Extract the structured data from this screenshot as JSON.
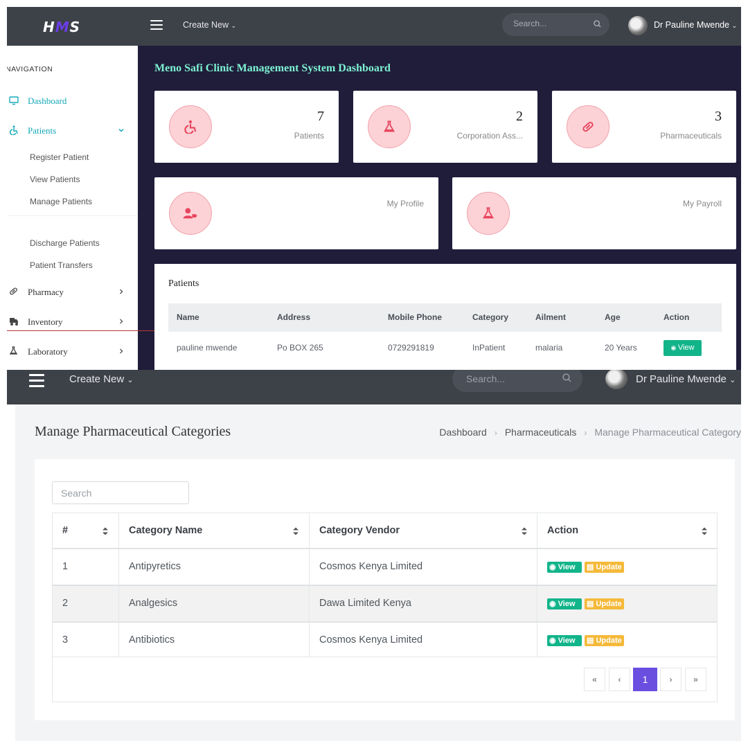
{
  "dashboard": {
    "topbar": {
      "logo_text_1": "H",
      "logo_text_2": "M",
      "logo_text_3": "S",
      "create_new_label": "Create New",
      "search_placeholder": "Search...",
      "user_name": "Dr Pauline Mwende"
    },
    "sidebar": {
      "heading": "NAVIGATION",
      "dashboard_label": "Dashboard",
      "patients_label": "Patients",
      "patients_sub": [
        "Register Patient",
        "View Patients",
        "Manage Patients",
        "Discharge Patients",
        "Patient Transfers"
      ],
      "pharmacy_label": "Pharmacy",
      "inventory_label": "Inventory",
      "laboratory_label": "Laboratory"
    },
    "title": "Meno Safi Clinic Management System Dashboard",
    "stat_cards": [
      {
        "value": "7",
        "label": "Patients",
        "icon": "wheelchair-icon"
      },
      {
        "value": "2",
        "label": "Corporation Ass...",
        "icon": "flask-icon"
      },
      {
        "value": "3",
        "label": "Pharmaceuticals",
        "icon": "pill-icon"
      }
    ],
    "link_cards": [
      {
        "label": "My Profile",
        "icon": "user-tag-icon"
      },
      {
        "label": "My Payroll",
        "icon": "flask-icon"
      }
    ],
    "patients_table": {
      "title": "Patients",
      "columns": [
        "Name",
        "Address",
        "Mobile Phone",
        "Category",
        "Ailment",
        "Age",
        "Action"
      ],
      "rows": [
        {
          "name": "pauline mwende",
          "address": "Po BOX 265",
          "phone": "0729291819",
          "category": "InPatient",
          "ailment": "malaria",
          "age": "20 Years",
          "action": "View"
        }
      ]
    }
  },
  "pharma_page": {
    "topbar": {
      "create_new_label": "Create New",
      "search_placeholder": "Search...",
      "user_name": "Dr Pauline Mwende"
    },
    "title": "Manage Pharmaceutical Categories",
    "breadcrumb": [
      "Dashboard",
      "Pharmaceuticals",
      "Manage Pharmaceutical Category"
    ],
    "search_placeholder": "Search",
    "table": {
      "columns": [
        "#",
        "Category Name",
        "Category Vendor",
        "Action"
      ],
      "rows": [
        {
          "num": "1",
          "name": "Antipyretics",
          "vendor": "Cosmos Kenya Limited"
        },
        {
          "num": "2",
          "name": "Analgesics",
          "vendor": "Dawa Limited Kenya"
        },
        {
          "num": "3",
          "name": "Antibiotics",
          "vendor": "Cosmos Kenya Limited"
        }
      ],
      "view_label": "View",
      "update_label": "Update"
    },
    "pagination": {
      "first": "«",
      "prev": "‹",
      "current": "1",
      "next": "›",
      "last": "»"
    }
  },
  "colors": {
    "topbar": "#3d4148",
    "dashboard_bg": "#1f1d3a",
    "title_teal": "#7ef3d3",
    "active_nav": "#13a8b8",
    "icon_circle": "#fcd2d6",
    "icon_red": "#e8455e",
    "view_green": "#12b48a",
    "update_orange": "#f5b93a",
    "pager_active": "#6a4ee0"
  }
}
